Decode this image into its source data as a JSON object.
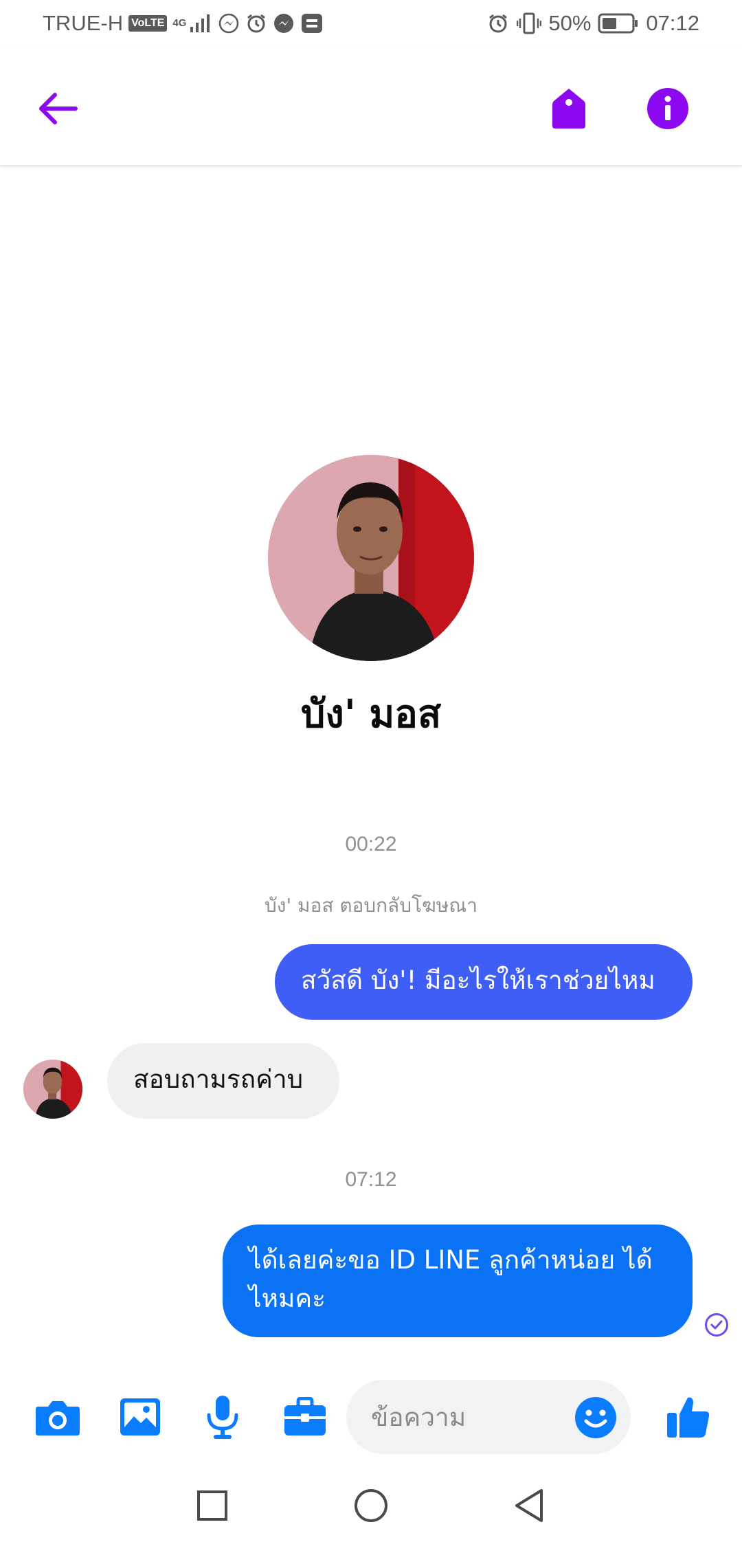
{
  "status_bar": {
    "carrier": "TRUE-H",
    "volte_badge": "VoLTE",
    "network_type": "4G",
    "battery_percent": "50%",
    "time": "07:12"
  },
  "app_bar": {
    "accent_color": "#8c08f1"
  },
  "profile": {
    "name": "บัง' มอส"
  },
  "conversation": {
    "timestamp_1": "00:22",
    "system_note": "บัง' มอส ตอบกลับโฆษณา",
    "outgoing_1": "สวัสดี บัง'! มีอะไรให้เราช่วยไหม",
    "incoming_1": "สอบถามรถค่าบ",
    "timestamp_2": "07:12",
    "outgoing_2": "ได้เลยค่ะขอ ID LINE ลูกค้าหน่อย ได้ไหมคะ"
  },
  "composer": {
    "placeholder": "ข้อความ",
    "icon_color": "#0a7cff"
  },
  "colors": {
    "outgoing_bubble_1": "#3f5ef5",
    "outgoing_bubble_2": "#0b72f5",
    "incoming_bubble": "#f0f0f0"
  }
}
